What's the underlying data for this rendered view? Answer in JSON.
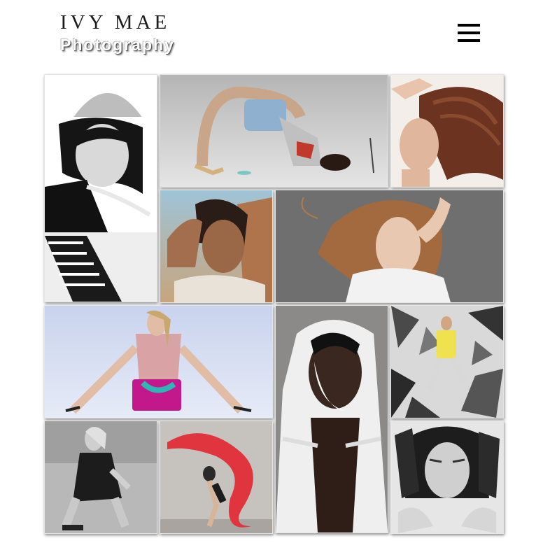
{
  "header": {
    "logo_line1": "IVY MAE",
    "logo_line2": "Photography",
    "menu_icon": "hamburger-menu-icon"
  },
  "gallery": {
    "tiles": [
      {
        "id": "bw-bob-portrait",
        "tone": "monochrome"
      },
      {
        "id": "backbend-pose",
        "tone": "cool-grey"
      },
      {
        "id": "long-hair-portrait",
        "tone": "warm"
      },
      {
        "id": "desert-portrait",
        "tone": "warm"
      },
      {
        "id": "windswept-hair-portrait",
        "tone": "grey"
      },
      {
        "id": "seated-handbag-pose",
        "tone": "light-blue"
      },
      {
        "id": "hooded-painted-face",
        "tone": "grey"
      },
      {
        "id": "shattered-glass-jump",
        "tone": "monochrome"
      },
      {
        "id": "crouching-bw-pose",
        "tone": "monochrome"
      },
      {
        "id": "red-fabric-dancer",
        "tone": "red-grey"
      },
      {
        "id": "mirror-portrait",
        "tone": "monochrome"
      }
    ]
  },
  "colors": {
    "background": "#ffffff",
    "logo_text": "#1c1c1c",
    "tile_border": "#e5e5e5"
  }
}
